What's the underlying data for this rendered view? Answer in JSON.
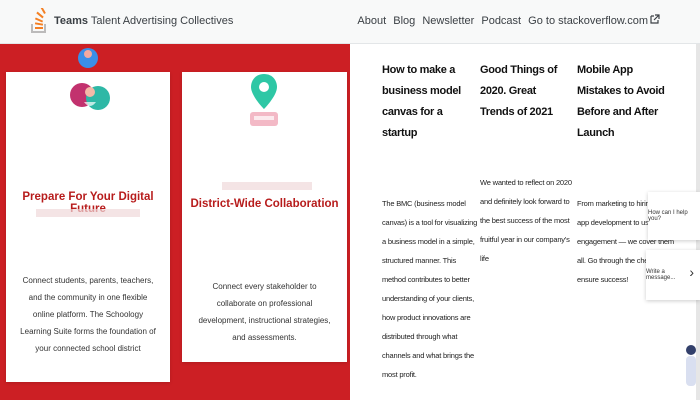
{
  "header": {
    "brand_bold": "Teams",
    "brand_rest": "Talent Advertising Collectives",
    "nav": [
      "About",
      "Blog",
      "Newsletter",
      "Podcast",
      "Go to stackoverflow.com"
    ]
  },
  "cards": [
    {
      "title": "Prepare For Your Digital Future",
      "body": "Connect students, parents, teachers, and the community in one flexible online platform. The Schoology Learning Suite forms the foundation of your connected school district"
    },
    {
      "title": "District-Wide Collaboration",
      "body": "Connect every stakeholder to collaborate on professional development, instructional strategies, and assessments."
    }
  ],
  "articles": [
    {
      "title": "How to make a business model canvas for a startup",
      "body": "The BMC (business model canvas) is a tool for visualizing a business model in a simple, structured manner. This method contributes to better understanding of your clients, how product innovations are distributed through what channels and what brings the most profit."
    },
    {
      "title": "Good Things of 2020. Great Trends of 2021",
      "body": "We wanted to reflect on 2020 and definitely look forward to the best success of the most fruitful year in our company's life"
    },
    {
      "title": "Mobile App Mistakes to Avoid Before and After Launch",
      "body": "From marketing to hiring, from app development to user engagement — we cover them all. Go through the checklist to ensure success!"
    }
  ],
  "widgets": {
    "first": "How can I help you?",
    "second": "Write a message..."
  },
  "colors": {
    "brand_red": "#cc1f24",
    "title_red": "#b71c1c",
    "so_orange": "#f48024"
  }
}
